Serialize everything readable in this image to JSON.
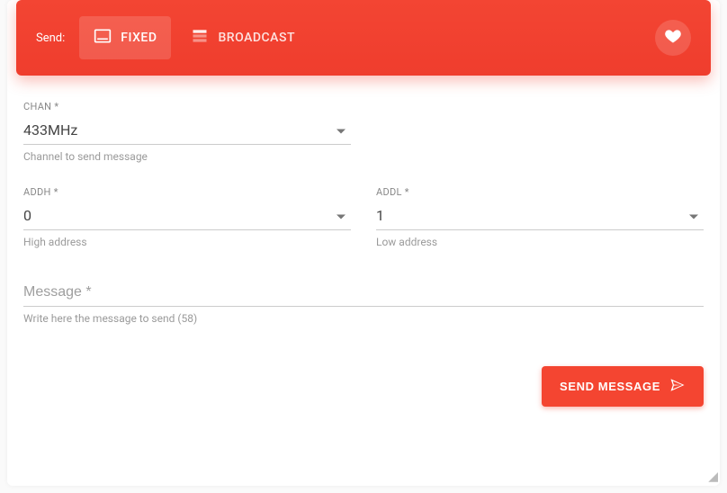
{
  "header": {
    "send_label": "Send:",
    "tabs": {
      "fixed": "FIXED",
      "broadcast": "BROADCAST"
    }
  },
  "fields": {
    "chan": {
      "label": "CHAN *",
      "value": "433MHz",
      "helper": "Channel to send message"
    },
    "addh": {
      "label": "ADDH *",
      "value": "0",
      "helper": "High address"
    },
    "addl": {
      "label": "ADDL *",
      "value": "1",
      "helper": "Low address"
    },
    "message": {
      "placeholder": "Message *",
      "helper": "Write here the message to send (58)"
    }
  },
  "actions": {
    "send": "SEND MESSAGE"
  }
}
